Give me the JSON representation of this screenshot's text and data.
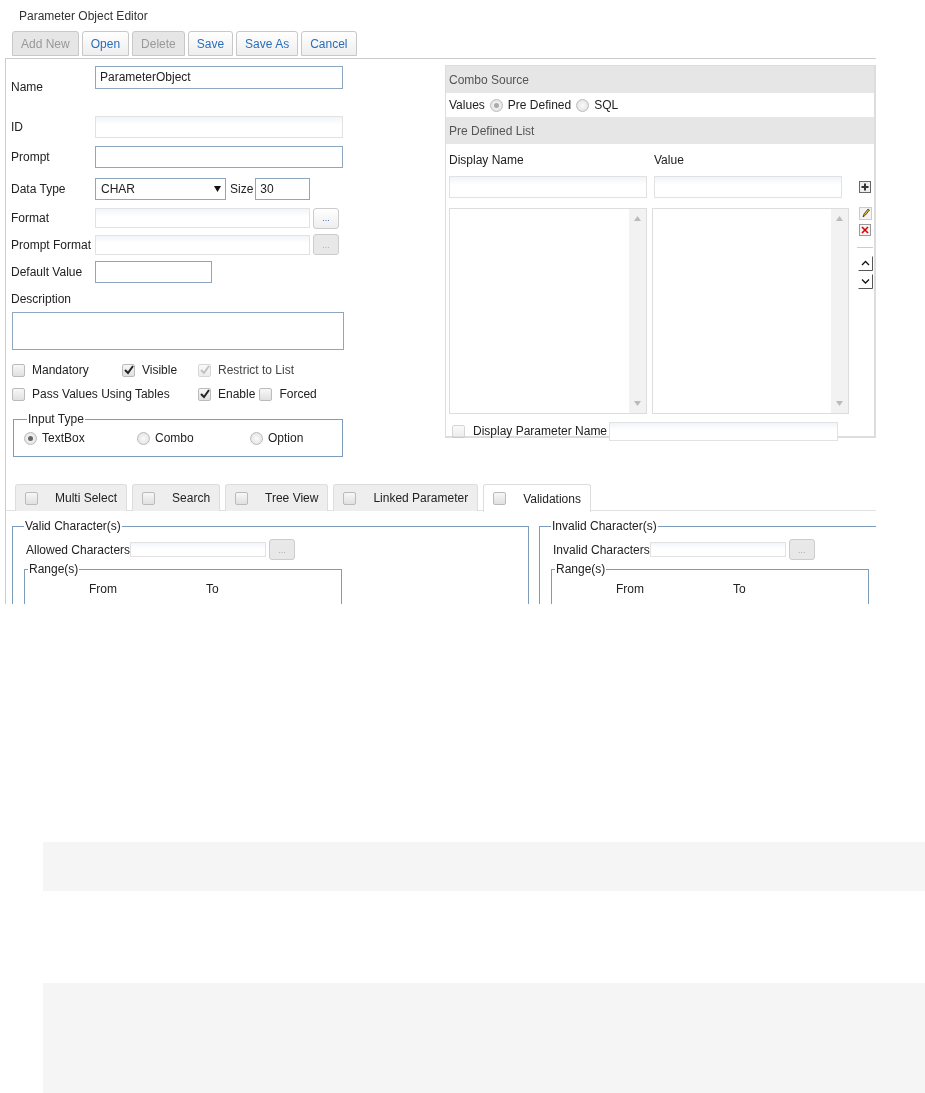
{
  "title": "Parameter Object Editor",
  "toolbar": [
    {
      "label": "Add New",
      "disabled": true
    },
    {
      "label": "Open",
      "disabled": false
    },
    {
      "label": "Delete",
      "disabled": true
    },
    {
      "label": "Save",
      "disabled": false
    },
    {
      "label": "Save As",
      "disabled": false
    },
    {
      "label": "Cancel",
      "disabled": false
    }
  ],
  "form": {
    "name": {
      "label": "Name",
      "value": "ParameterObject"
    },
    "id": {
      "label": "ID",
      "disabled": true
    },
    "prompt": {
      "label": "Prompt"
    },
    "data_type": {
      "label": "Data Type",
      "value": "CHAR",
      "size_label": "Size",
      "size_value": "30"
    },
    "format": {
      "label": "Format",
      "button": "...",
      "button_disabled": false
    },
    "prompt_format": {
      "label": "Prompt Format",
      "button": "...",
      "button_disabled": true
    },
    "default_value": {
      "label": "Default Value"
    },
    "description": {
      "label": "Description"
    }
  },
  "option_rows": [
    [
      {
        "label": "Mandatory",
        "checked": false,
        "disabled": false
      },
      {
        "label": "Visible",
        "checked": true,
        "disabled": false
      },
      {
        "label": "Restrict to List",
        "checked": true,
        "disabled": true
      }
    ],
    [
      {
        "label": "Pass Values Using Tables",
        "checked": false,
        "disabled": false
      },
      {
        "label": "Enable",
        "checked": true,
        "disabled": false
      },
      {
        "label": "Forced",
        "checked": false,
        "disabled": false
      }
    ]
  ],
  "input_type": {
    "legend": "Input Type",
    "options": [
      {
        "label": "TextBox",
        "selected": true
      },
      {
        "label": "Combo",
        "selected": false
      },
      {
        "label": "Option",
        "selected": false
      }
    ]
  },
  "combo_source": {
    "header": "Combo Source",
    "values_label": "Values",
    "disabled": true,
    "options": [
      {
        "label": "Pre Defined",
        "selected": true
      },
      {
        "label": "SQL",
        "selected": false
      }
    ],
    "list_header": "Pre Defined List",
    "columns": [
      "Display Name",
      "Value"
    ],
    "display_parameter": {
      "label": "Display Parameter Name",
      "checked": false
    }
  },
  "tabs": [
    {
      "label": "Multi Select",
      "checked": false,
      "selected": false
    },
    {
      "label": "Search",
      "checked": false,
      "selected": false
    },
    {
      "label": "Tree View",
      "checked": false,
      "selected": false
    },
    {
      "label": "Linked Parameter",
      "checked": false,
      "selected": false
    },
    {
      "label": "Validations",
      "checked": false,
      "selected": true
    }
  ],
  "validations": [
    {
      "legend": "Valid Character(s)",
      "field_label": "Allowed Characters",
      "button": "...",
      "ranges": {
        "legend": "Range(s)",
        "columns": [
          "From",
          "To"
        ]
      }
    },
    {
      "legend": "Invalid Character(s)",
      "field_label": "Invalid Characters",
      "button": "...",
      "ranges": {
        "legend": "Range(s)",
        "columns": [
          "From",
          "To"
        ]
      }
    }
  ]
}
